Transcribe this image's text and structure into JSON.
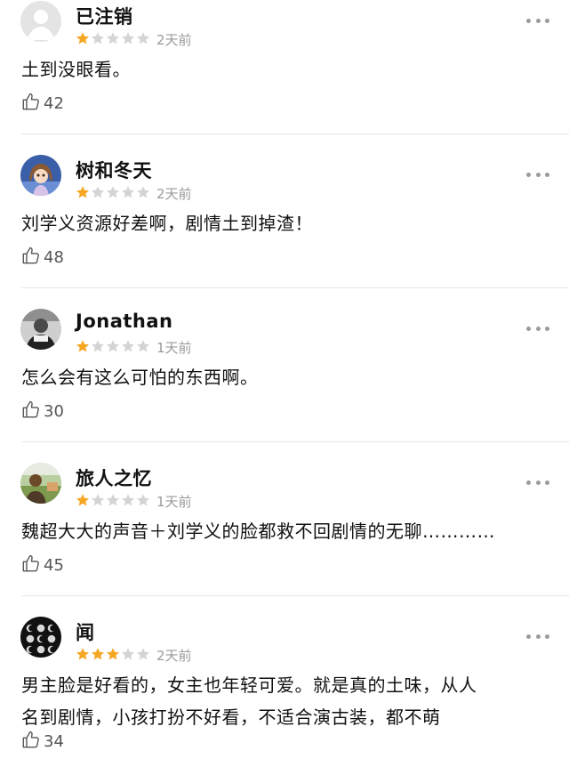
{
  "reviews": [
    {
      "username": "已注销",
      "rating": 1,
      "time": "2天前",
      "content": [
        "土到没眼看。"
      ],
      "likes": "42",
      "avatar": "default-avatar-icon"
    },
    {
      "username": "树和冬天",
      "rating": 1,
      "time": "2天前",
      "content": [
        "刘学义资源好差啊，剧情土到掉渣！"
      ],
      "likes": "48",
      "avatar": "anime-girl-avatar"
    },
    {
      "username": "Jonathan",
      "rating": 1,
      "time": "1天前",
      "content": [
        "怎么会有这么可怕的东西啊。"
      ],
      "likes": "30",
      "avatar": "person-photo-avatar"
    },
    {
      "username": "旅人之忆",
      "rating": 1,
      "time": "1天前",
      "content": [
        "魏超大大的声音＋刘学义的脸都救不回剧情的无聊…………"
      ],
      "likes": "45",
      "avatar": "outdoor-photo-avatar"
    },
    {
      "username": "闻",
      "rating": 3,
      "time": "2天前",
      "content": [
        "男主脸是好看的，女主也年轻可爱。就是真的土味，从人",
        "名到剧情，小孩打扮不好看，不适合演古装，都不萌"
      ],
      "likes": "34",
      "avatar": "moon-phases-avatar"
    }
  ],
  "colors": {
    "star_filled": "#f5a623",
    "star_empty": "#d4d4d4",
    "time": "#9a9a9a",
    "divider": "#e6e6e6"
  },
  "icons": {
    "like": "thumbs-up-icon",
    "more": "more-options-icon"
  }
}
